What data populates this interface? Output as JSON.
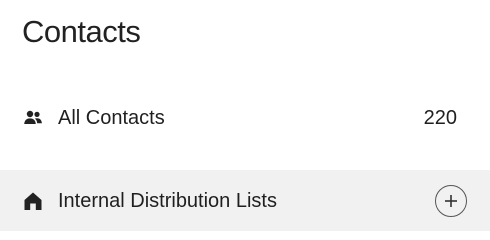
{
  "header": {
    "title": "Contacts"
  },
  "list": {
    "all_contacts": {
      "label": "All Contacts",
      "count": "220",
      "icon": "people-icon"
    },
    "internal_lists": {
      "label": "Internal Distribution Lists",
      "icon": "home-icon",
      "add_icon": "plus-circle-icon"
    }
  },
  "colors": {
    "selected_row_background": "#f1f1f1",
    "text": "#1f1f1f"
  }
}
